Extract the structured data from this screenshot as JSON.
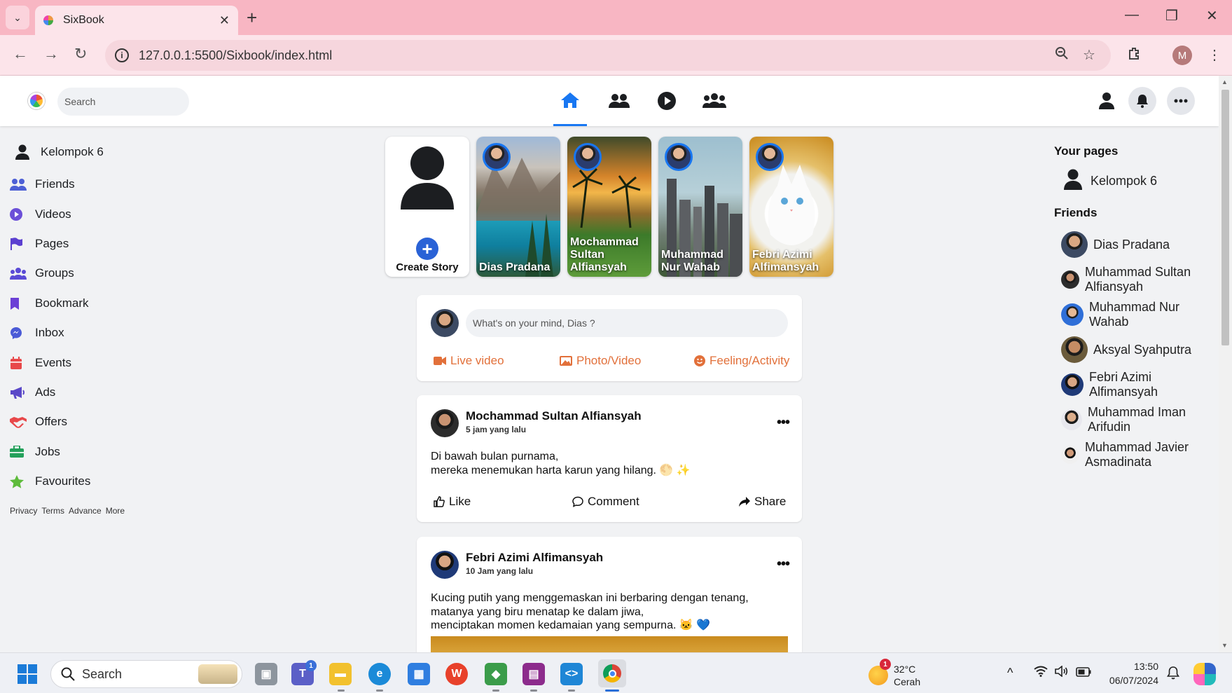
{
  "browser": {
    "tab_title": "SixBook",
    "url": "127.0.0.1:5500/Sixbook/index.html",
    "profile_initial": "M"
  },
  "header": {
    "search_placeholder": "Search"
  },
  "sidebar": {
    "profile_name": "Kelompok 6",
    "items": [
      {
        "label": "Friends",
        "icon": "friends-icon",
        "color": "#4c5fd5"
      },
      {
        "label": "Videos",
        "icon": "play-icon",
        "color": "#6b4fd8"
      },
      {
        "label": "Pages",
        "icon": "flag-icon",
        "color": "#5b3fd0"
      },
      {
        "label": "Groups",
        "icon": "groups-icon",
        "color": "#5a4ad6"
      },
      {
        "label": "Bookmark",
        "icon": "bookmark-icon",
        "color": "#6b3fd6"
      },
      {
        "label": "Inbox",
        "icon": "messenger-icon",
        "color": "#4a5ad6"
      },
      {
        "label": "Events",
        "icon": "calendar-icon",
        "color": "#e8484a"
      },
      {
        "label": "Ads",
        "icon": "megaphone-icon",
        "color": "#5a48c8"
      },
      {
        "label": "Offers",
        "icon": "handshake-icon",
        "color": "#e8484a"
      },
      {
        "label": "Jobs",
        "icon": "briefcase-icon",
        "color": "#23a05a"
      },
      {
        "label": "Favourites",
        "icon": "star-icon",
        "color": "#5dbb3a"
      }
    ],
    "footer_links": [
      "Privacy",
      "Terms",
      "Advance",
      "More"
    ]
  },
  "stories": {
    "create_label": "Create Story",
    "items": [
      {
        "name": "Dias Pradana"
      },
      {
        "name": "Mochammad Sultan Alfiansyah"
      },
      {
        "name": "Muhammad Nur Wahab"
      },
      {
        "name": "Febri Azimi Alfimansyah"
      }
    ]
  },
  "composer": {
    "placeholder": "What's on your mind, Dias ?",
    "live_video": "Live video",
    "photo_video": "Photo/Video",
    "feeling": "Feeling/Activity"
  },
  "posts": [
    {
      "author": "Mochammad Sultan Alfiansyah",
      "time": "5 jam yang lalu",
      "line1": "Di bawah bulan purnama,",
      "line2": "mereka menemukan harta karun yang hilang. 🌕 ✨",
      "like": "Like",
      "comment": "Comment",
      "share": "Share"
    },
    {
      "author": "Febri Azimi Alfimansyah",
      "time": "10 Jam yang lalu",
      "line1": "Kucing putih yang menggemaskan ini berbaring dengan tenang,",
      "line2": "matanya yang biru menatap ke dalam jiwa,",
      "line3": "menciptakan momen kedamaian yang sempurna. 🐱 💙"
    }
  ],
  "right": {
    "pages_title": "Your pages",
    "page_name": "Kelompok 6",
    "friends_title": "Friends",
    "friends": [
      {
        "name": "Dias Pradana"
      },
      {
        "name": "Muhammad Sultan Alfiansyah"
      },
      {
        "name": "Muhammad Nur Wahab"
      },
      {
        "name": "Aksyal Syahputra"
      },
      {
        "name": "Febri Azimi Alfimansyah"
      },
      {
        "name": "Muhammad Iman Arifudin"
      },
      {
        "name": "Muhammad Javier Asmadinata"
      }
    ]
  },
  "taskbar": {
    "search_placeholder": "Search",
    "teams_badge": "1",
    "weather_badge": "1",
    "temperature": "32°C",
    "weather": "Cerah",
    "time": "13:50",
    "date": "06/07/2024"
  }
}
